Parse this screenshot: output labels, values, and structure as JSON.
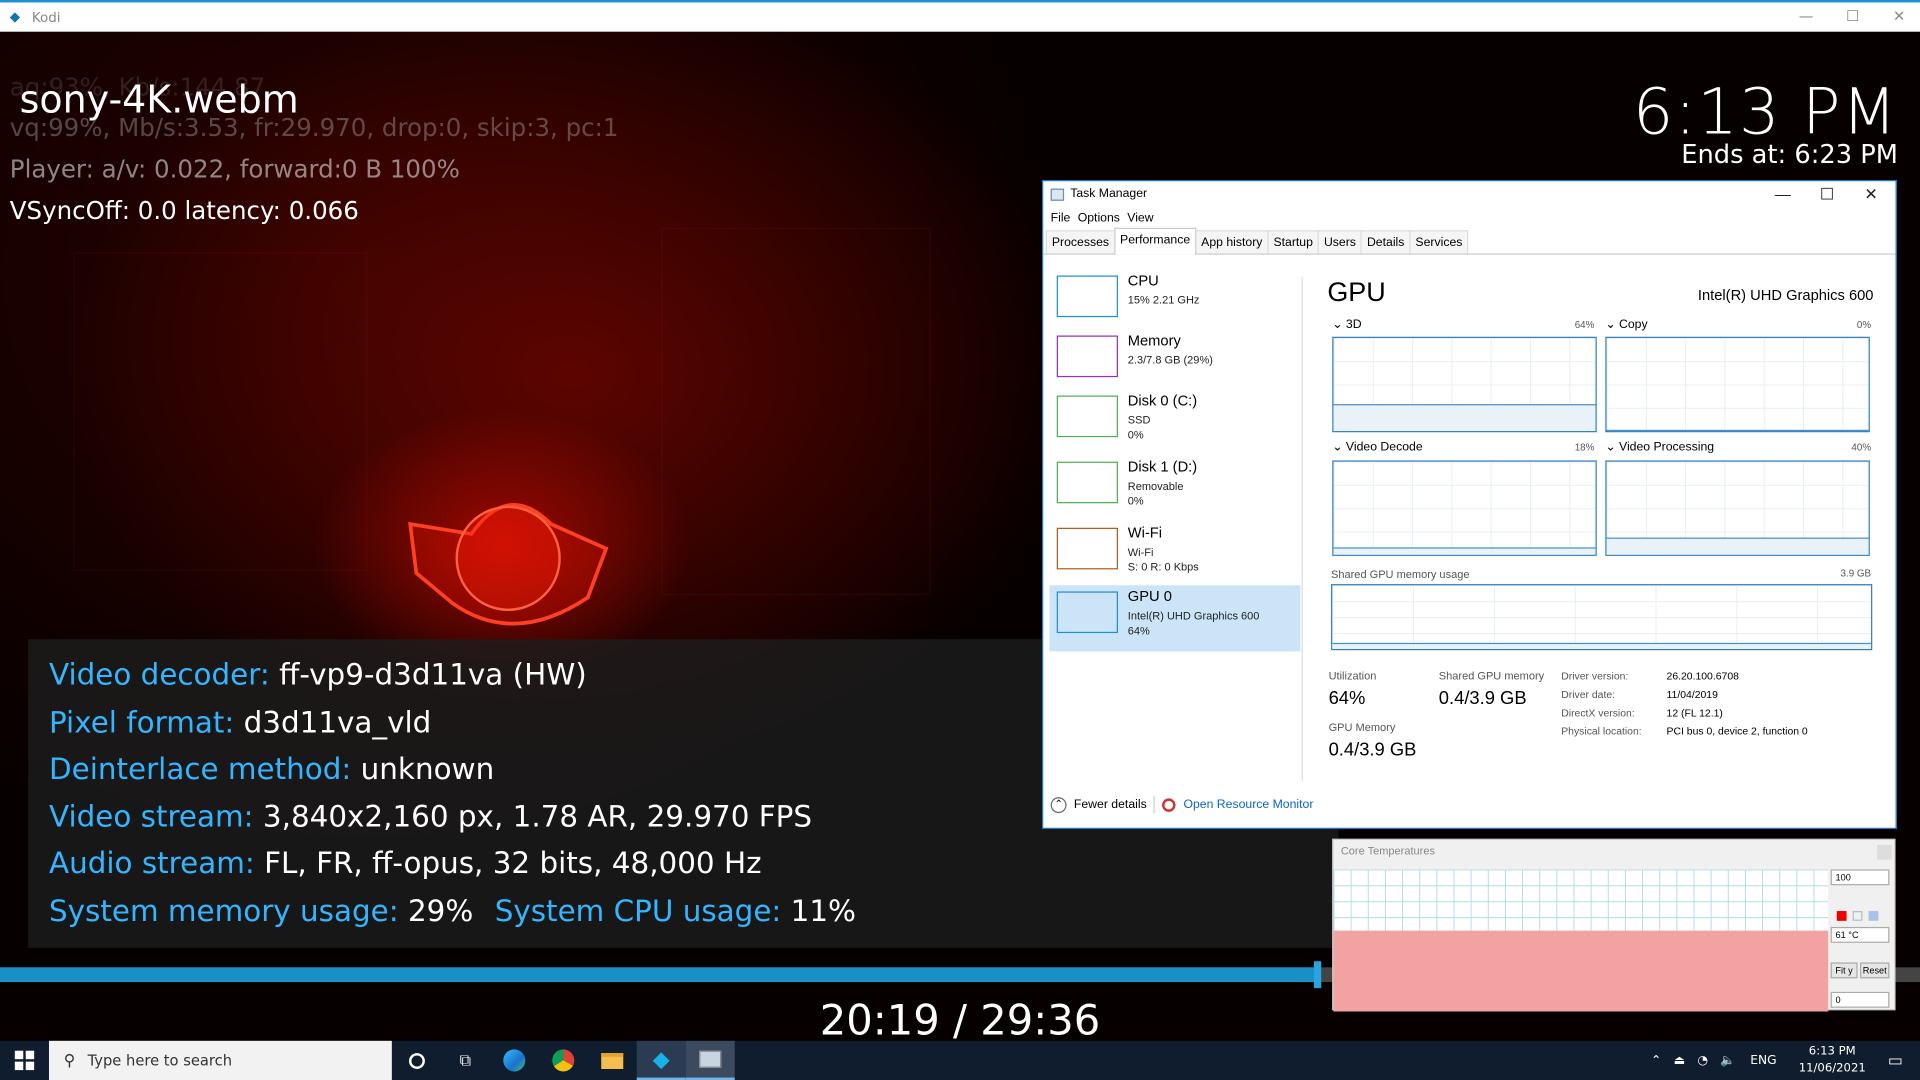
{
  "window": {
    "title": "Kodi",
    "minimize": "—",
    "maximize": "☐",
    "close": "✕"
  },
  "osd": {
    "filename": "sony-4K.webm",
    "debug_faded": "aq:93%, Kb/s:144.87",
    "debug_video": "vq:99%, Mb/s:3.53, fr:29.970, drop:0, skip:3, pc:1",
    "debug_player": "Player: a/v: 0.022,  forward:0 B 100%",
    "debug_vsync": "VSyncOff: 0.0 latency: 0.066",
    "clock": "6:13 PM",
    "ends_at": "Ends at: 6:23 PM",
    "info": [
      {
        "key": "Video decoder:",
        "value": "ff-vp9-d3d11va (HW)"
      },
      {
        "key": "Pixel format:",
        "value": "d3d11va_vld"
      },
      {
        "key": "Deinterlace method:",
        "value": "unknown"
      },
      {
        "key": "Video stream:",
        "value": "3,840x2,160 px, 1.78 AR, 29.970 FPS"
      },
      {
        "key": "Audio stream:",
        "value": "FL, FR, ff-opus, 32 bits, 48,000 Hz"
      },
      {
        "key": "System memory usage:",
        "value": "29%"
      },
      {
        "key": "System CPU usage:",
        "value": "11%"
      }
    ],
    "playtime": "20:19 / 29:36",
    "progress_fraction": 0.686
  },
  "taskmanager": {
    "title": "Task Manager",
    "menu": [
      "File",
      "Options",
      "View"
    ],
    "tabs": [
      "Processes",
      "Performance",
      "App history",
      "Startup",
      "Users",
      "Details",
      "Services"
    ],
    "active_tab": "Performance",
    "sidebar": [
      {
        "name": "CPU",
        "sub1": "15% 2.21 GHz",
        "sub2": "",
        "sub3": "",
        "color": "#1f8fd1"
      },
      {
        "name": "Memory",
        "sub1": "2.3/7.8 GB (29%)",
        "sub2": "",
        "sub3": "",
        "color": "#9a2fb0"
      },
      {
        "name": "Disk 0 (C:)",
        "sub1": "SSD",
        "sub2": "0%",
        "sub3": "",
        "color": "#4caf50"
      },
      {
        "name": "Disk 1 (D:)",
        "sub1": "Removable",
        "sub2": "0%",
        "sub3": "",
        "color": "#4caf50"
      },
      {
        "name": "Wi-Fi",
        "sub1": "Wi-Fi",
        "sub2": "S: 0 R: 0 Kbps",
        "sub3": "",
        "color": "#b35a1a"
      },
      {
        "name": "GPU 0",
        "sub1": "Intel(R) UHD Graphics 600",
        "sub2": "64%",
        "sub3": "",
        "color": "#1f8fd1"
      }
    ],
    "gpu": {
      "title": "GPU",
      "model": "Intel(R) UHD Graphics 600",
      "engines": [
        {
          "label": "3D",
          "percent": "64%",
          "level": 0.64
        },
        {
          "label": "Copy",
          "percent": "0%",
          "level": 0
        },
        {
          "label": "Video Decode",
          "percent": "18%",
          "level": 0.18
        },
        {
          "label": "Video Processing",
          "percent": "40%",
          "level": 0.4
        }
      ],
      "shared_label": "Shared GPU memory usage",
      "shared_max": "3.9 GB",
      "utilization_label": "Utilization",
      "utilization": "64%",
      "shared_mem_label": "Shared GPU memory",
      "shared_mem": "0.4/3.9 GB",
      "gpu_mem_label": "GPU Memory",
      "gpu_mem": "0.4/3.9 GB",
      "details": [
        {
          "k": "Driver version:",
          "v": "26.20.100.6708"
        },
        {
          "k": "Driver date:",
          "v": "11/04/2019"
        },
        {
          "k": "DirectX version:",
          "v": "12 (FL 12.1)"
        },
        {
          "k": "Physical location:",
          "v": "PCI bus 0, device 2, function 0"
        }
      ]
    },
    "fewer_details": "Fewer details",
    "open_rm": "Open Resource Monitor"
  },
  "coretemp": {
    "title": "Core Temperatures",
    "max": "100",
    "temp": "61 °C",
    "min": "0",
    "fit": "Fit y",
    "reset": "Reset",
    "level": 0.57
  },
  "taskbar": {
    "search_placeholder": "Type here to search",
    "lang": "ENG",
    "time": "6:13 PM",
    "date": "11/06/2021",
    "icons": [
      "cortana-icon",
      "task-view-icon",
      "edge-icon",
      "chrome-icon",
      "file-explorer-icon",
      "kodi-icon",
      "app-icon"
    ]
  }
}
